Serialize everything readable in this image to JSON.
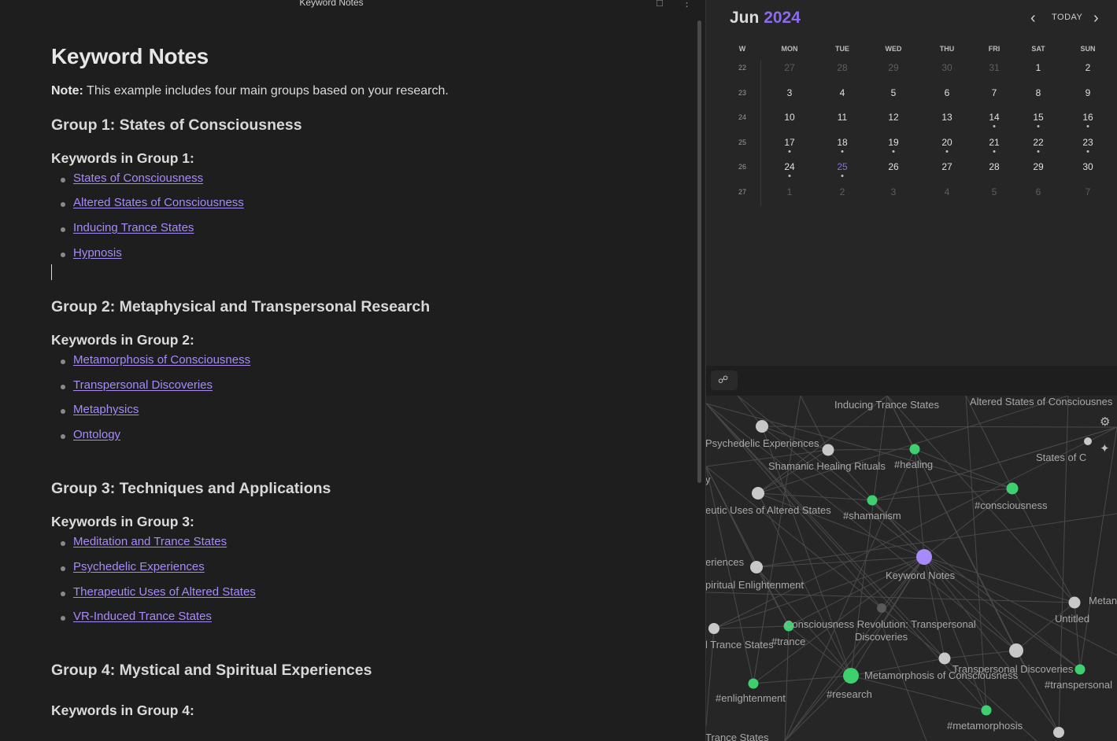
{
  "editor": {
    "tab_title": "Keyword Notes",
    "title": "Keyword Notes",
    "note_label": "Note:",
    "note_text": " This example includes four main groups based on your research.",
    "groups": [
      {
        "heading": "Group 1: States of Consciousness",
        "keywords_label": "Keywords in Group 1:",
        "links": [
          "States of Consciousness",
          "Altered States of Consciousness",
          "Inducing Trance States",
          "Hypnosis"
        ]
      },
      {
        "heading": "Group 2: Metaphysical and Transpersonal Research",
        "keywords_label": "Keywords in Group 2:",
        "links": [
          "Metamorphosis of Consciousness",
          "Transpersonal Discoveries",
          "Metaphysics",
          "Ontology"
        ]
      },
      {
        "heading": "Group 3: Techniques and Applications",
        "keywords_label": "Keywords in Group 3:",
        "links": [
          "Meditation and Trance States",
          "Psychedelic Experiences",
          "Therapeutic Uses of Altered States",
          "VR-Induced Trance States"
        ]
      },
      {
        "heading": "Group 4: Mystical and Spiritual Experiences",
        "keywords_label": "Keywords in Group 4:",
        "links": []
      }
    ]
  },
  "calendar": {
    "month": "Jun",
    "year": "2024",
    "today_label": "TODAY",
    "week_header": "W",
    "day_headers": [
      "MON",
      "TUE",
      "WED",
      "THU",
      "FRI",
      "SAT",
      "SUN"
    ],
    "weeks": [
      {
        "num": "22",
        "days": [
          {
            "d": "27",
            "adj": true
          },
          {
            "d": "28",
            "adj": true
          },
          {
            "d": "29",
            "adj": true
          },
          {
            "d": "30",
            "adj": true
          },
          {
            "d": "31",
            "adj": true
          },
          {
            "d": "1"
          },
          {
            "d": "2"
          }
        ]
      },
      {
        "num": "23",
        "days": [
          {
            "d": "3"
          },
          {
            "d": "4"
          },
          {
            "d": "5"
          },
          {
            "d": "6"
          },
          {
            "d": "7"
          },
          {
            "d": "8"
          },
          {
            "d": "9"
          }
        ]
      },
      {
        "num": "24",
        "days": [
          {
            "d": "10"
          },
          {
            "d": "11"
          },
          {
            "d": "12"
          },
          {
            "d": "13"
          },
          {
            "d": "14",
            "dot": true
          },
          {
            "d": "15",
            "dot": true
          },
          {
            "d": "16",
            "dot": true
          }
        ]
      },
      {
        "num": "25",
        "days": [
          {
            "d": "17",
            "dot": true
          },
          {
            "d": "18",
            "dot": true
          },
          {
            "d": "19",
            "dot": true
          },
          {
            "d": "20",
            "dot": true
          },
          {
            "d": "21",
            "dot": true
          },
          {
            "d": "22",
            "dot": true
          },
          {
            "d": "23",
            "dot": true
          }
        ]
      },
      {
        "num": "26",
        "days": [
          {
            "d": "24",
            "dot": true
          },
          {
            "d": "25",
            "today": true,
            "dot": true
          },
          {
            "d": "26"
          },
          {
            "d": "27"
          },
          {
            "d": "28"
          },
          {
            "d": "29"
          },
          {
            "d": "30"
          }
        ]
      },
      {
        "num": "27",
        "days": [
          {
            "d": "1",
            "adj": true
          },
          {
            "d": "2",
            "adj": true
          },
          {
            "d": "3",
            "adj": true
          },
          {
            "d": "4",
            "adj": true
          },
          {
            "d": "5",
            "adj": true
          },
          {
            "d": "6",
            "adj": true
          },
          {
            "d": "7",
            "adj": true
          }
        ]
      }
    ],
    "colors": {
      "accent": "#8b6cf0"
    }
  },
  "graph": {
    "colors": {
      "note_node": "#c8c8c8",
      "tag_node": "#3ecf6e",
      "active_node": "#a78bfa",
      "unresolved_node": "#5a5a5a",
      "edge": "#4a4a4a"
    },
    "nodes": [
      {
        "id": "psychedelic",
        "label": "Psychedelic Experiences",
        "kind": "note"
      },
      {
        "id": "shamanic",
        "label": "Shamanic Healing Rituals",
        "kind": "note"
      },
      {
        "id": "healing",
        "label": "#healing",
        "kind": "tag"
      },
      {
        "id": "consciousness_tag",
        "label": "#consciousness",
        "kind": "tag"
      },
      {
        "id": "therapeutic",
        "label": "eutic Uses of Altered States",
        "kind": "note"
      },
      {
        "id": "shamanism",
        "label": "#shamanism",
        "kind": "tag"
      },
      {
        "id": "spiritual",
        "label": "piritual Enlightenment",
        "kind": "note"
      },
      {
        "id": "keyword",
        "label": "Keyword Notes",
        "kind": "active"
      },
      {
        "id": "unresolved",
        "label": "",
        "kind": "unresolved"
      },
      {
        "id": "untitled",
        "label": "Untitled",
        "kind": "note"
      },
      {
        "id": "trance_states",
        "label": "l Trance States",
        "kind": "note"
      },
      {
        "id": "trance_tag",
        "label": "#trance",
        "kind": "tag"
      },
      {
        "id": "revolution",
        "label": "Consciousness Revolution: Transpersonal Discoveries",
        "kind": "note"
      },
      {
        "id": "metamorphosis",
        "label": "Metamorphosis of Consciousness",
        "kind": "note"
      },
      {
        "id": "transpersonal_disc",
        "label": "Transpersonal Discoveries",
        "kind": "note"
      },
      {
        "id": "transpersonal_tag",
        "label": "#transpersonal",
        "kind": "tag"
      },
      {
        "id": "enlightenment",
        "label": "#enlightenment",
        "kind": "tag"
      },
      {
        "id": "research",
        "label": "#research",
        "kind": "tag"
      },
      {
        "id": "metamorphosis_tag",
        "label": "#metamorphosis",
        "kind": "tag"
      },
      {
        "id": "bottom",
        "label": "",
        "kind": "note"
      }
    ],
    "edge_labels": [
      {
        "label": "Inducing Trance States"
      },
      {
        "label": "Altered States of Consciousnes"
      },
      {
        "label": "States of C"
      },
      {
        "label": "eriences"
      },
      {
        "label": "Trance States"
      },
      {
        "label": "Metan"
      },
      {
        "label": "y"
      }
    ]
  }
}
